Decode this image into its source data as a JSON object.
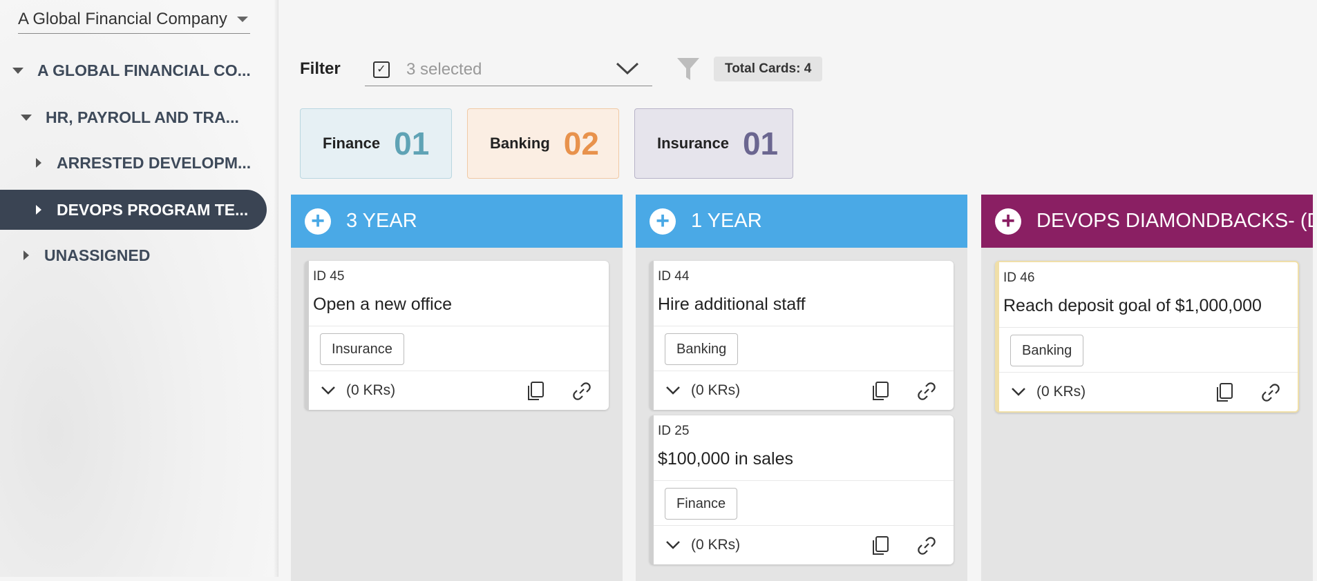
{
  "sidebar": {
    "company_select": "A Global Financial Company",
    "tree": [
      {
        "label": "A GLOBAL FINANCIAL CO...",
        "expanded": true
      },
      {
        "label": "HR, PAYROLL AND TRA...",
        "expanded": true
      },
      {
        "label": "ARRESTED DEVELOPM...",
        "expanded": false
      },
      {
        "label": "DEVOPS PROGRAM TE...",
        "expanded": false,
        "active": true
      },
      {
        "label": "UNASSIGNED",
        "expanded": false
      }
    ]
  },
  "filter": {
    "label": "Filter",
    "selected_text": "3 selected",
    "total_cards": "Total Cards: 4"
  },
  "categories": [
    {
      "name": "Finance",
      "count": "01",
      "color": "#5fa3b5",
      "bg": "#e6f0f4",
      "border": "#b9d6e0"
    },
    {
      "name": "Banking",
      "count": "02",
      "color": "#e8924c",
      "bg": "#fbeee3",
      "border": "#f0c9a5"
    },
    {
      "name": "Insurance",
      "count": "01",
      "color": "#6b6690",
      "bg": "#e6e4ec",
      "border": "#b7b3c8"
    }
  ],
  "columns": [
    {
      "title": "3 YEAR",
      "color": "#4aa9e6",
      "cards": [
        {
          "id": "ID 45",
          "title": "Open a new office",
          "tag": "Insurance",
          "krs": "(0 KRs)"
        }
      ]
    },
    {
      "title": "1 YEAR",
      "color": "#4aa9e6",
      "cards": [
        {
          "id": "ID 44",
          "title": "Hire additional staff",
          "tag": "Banking",
          "krs": "(0 KRs)"
        },
        {
          "id": "ID 25",
          "title": "$100,000 in sales",
          "tag": "Finance",
          "krs": "(0 KRs)"
        }
      ]
    },
    {
      "title": "DEVOPS DIAMONDBACKS- (D...",
      "color": "#8a1f63",
      "cards": [
        {
          "id": "ID 46",
          "title": "Reach deposit goal of $1,000,000",
          "tag": "Banking",
          "krs": "(0 KRs)"
        }
      ]
    }
  ]
}
